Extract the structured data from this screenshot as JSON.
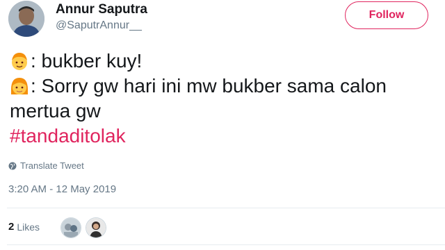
{
  "author": {
    "name": "Annur Saputra",
    "handle": "@SaputrAnnur__"
  },
  "follow_button": {
    "label": "Follow"
  },
  "tweet": {
    "line1": ": bukber kuy!",
    "line2": ": Sorry gw hari ini mw bukber sama calon",
    "line3": "mertua gw",
    "hashtag": "#tandaditolak"
  },
  "translate": {
    "label": "Translate Tweet"
  },
  "timestamp": "3:20 AM - 12 May 2019",
  "likes": {
    "count": "2",
    "label": "Likes"
  },
  "colors": {
    "accent": "#e0245e",
    "secondary_text": "#657786",
    "divider": "#e6ecf0"
  }
}
